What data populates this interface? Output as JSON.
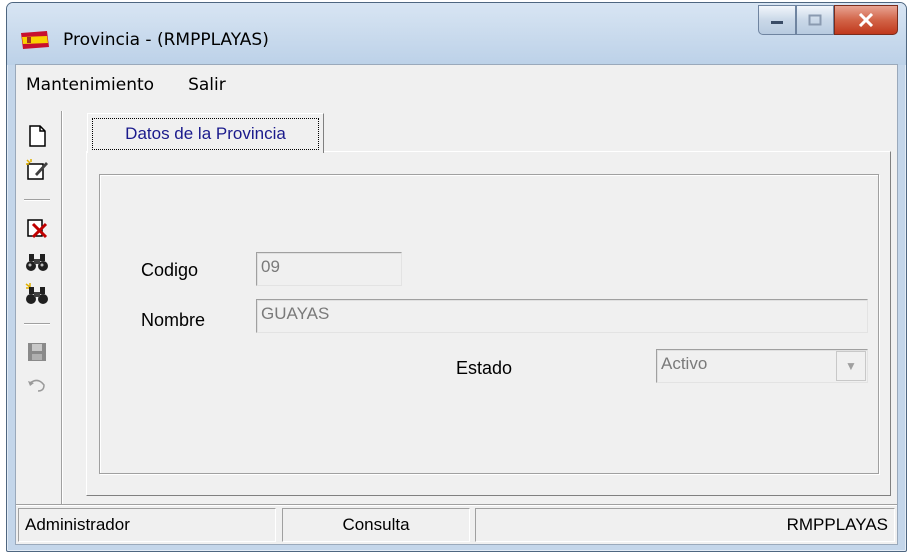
{
  "window": {
    "title": "Provincia - (RMPPLAYAS)",
    "app_icon": "spain-flag-icon"
  },
  "caption_buttons": {
    "minimize": "minimize-icon",
    "maximize": "maximize-icon",
    "close": "close-icon"
  },
  "menu": {
    "items": [
      "Mantenimiento",
      "Salir"
    ]
  },
  "toolbar": {
    "buttons": [
      "new-document-icon",
      "edit-icon",
      "delete-icon",
      "search-icon",
      "search-advanced-icon",
      "save-icon",
      "undo-icon"
    ]
  },
  "tab": {
    "label": "Datos de la Provincia"
  },
  "form": {
    "codigo_label": "Codigo",
    "codigo_value": "09",
    "nombre_label": "Nombre",
    "nombre_value": "GUAYAS",
    "estado_label": "Estado",
    "estado_value": "Activo"
  },
  "statusbar": {
    "user": "Administrador",
    "mode": "Consulta",
    "database": "RMPPLAYAS"
  }
}
